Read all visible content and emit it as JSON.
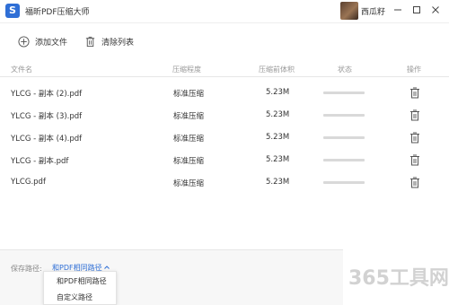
{
  "titlebar": {
    "app_title": "福昕PDF压缩大师",
    "username": "西瓜籽",
    "logo_letter": "S"
  },
  "toolbar": {
    "add_label": "添加文件",
    "clear_label": "清除列表"
  },
  "table": {
    "headers": {
      "name": "文件名",
      "level": "压缩程度",
      "size": "压缩前体积",
      "status": "状态",
      "action": "操作"
    },
    "rows": [
      {
        "name": "YLCG - 副本 (2).pdf",
        "level": "标准压缩",
        "size": "5.23M",
        "progress": 0
      },
      {
        "name": "YLCG - 副本 (3).pdf",
        "level": "标准压缩",
        "size": "5.23M",
        "progress": 0
      },
      {
        "name": "YLCG - 副本 (4).pdf",
        "level": "标准压缩",
        "size": "5.23M",
        "progress": 0
      },
      {
        "name": "YLCG - 副本.pdf",
        "level": "标准压缩",
        "size": "5.23M",
        "progress": 0
      },
      {
        "name": "YLCG.pdf",
        "level": "标准压缩",
        "size": "5.23M",
        "progress": 0
      }
    ]
  },
  "footer": {
    "save_path_label": "保存路径:",
    "save_path_value": "和PDF相同路径",
    "options": [
      "和PDF相同路径",
      "自定义路径"
    ]
  },
  "watermark": {
    "text": "365工具网"
  },
  "colors": {
    "accent": "#2f6fd6",
    "progress_track": "#d9d9d9"
  },
  "icons": [
    "app-logo-icon",
    "minimize-icon",
    "maximize-icon",
    "close-icon",
    "plus-circle-icon",
    "trash-icon",
    "chevron-up-icon"
  ]
}
